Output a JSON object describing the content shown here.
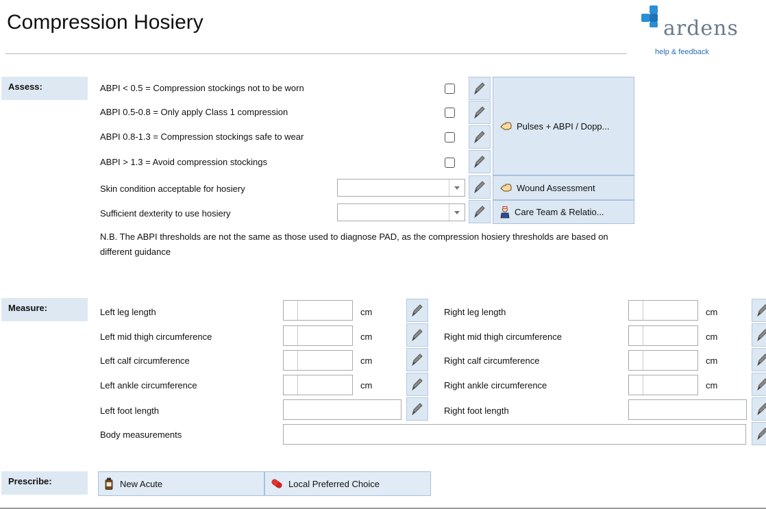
{
  "header": {
    "title": "Compression Hosiery",
    "brand": "ardens",
    "help_link": "help & feedback"
  },
  "colors": {
    "brand_blue": "#2a8fd6",
    "section_bg": "#dde8f3",
    "button_bg": "#dbe7f3"
  },
  "assess": {
    "label": "Assess:",
    "abpi_rows": [
      {
        "label": "ABPI < 0.5 = Compression stockings not to be worn",
        "checked": false
      },
      {
        "label": "ABPI 0.5-0.8 = Only apply Class 1 compression",
        "checked": false
      },
      {
        "label": "ABPI 0.8-1.3 = Compression stockings safe to wear",
        "checked": false
      },
      {
        "label": "ABPI > 1.3 = Avoid compression stockings",
        "checked": false
      }
    ],
    "dropdowns": [
      {
        "label": "Skin condition acceptable for hosiery",
        "value": ""
      },
      {
        "label": "Sufficient dexterity to use hosiery",
        "value": ""
      }
    ],
    "buttons": {
      "pulses": "Pulses + ABPI / Dopp...",
      "wound": "Wound Assessment",
      "care_team": "Care Team & Relatio..."
    },
    "note": "N.B. The ABPI thresholds are not the same as those used to diagnose PAD, as the compression hosiery thresholds are based on different guidance"
  },
  "measure": {
    "label": "Measure:",
    "unit": "cm",
    "left": [
      {
        "label": "Left leg length",
        "value": ""
      },
      {
        "label": "Left mid thigh circumference",
        "value": ""
      },
      {
        "label": "Left calf circumference",
        "value": ""
      },
      {
        "label": "Left ankle circumference",
        "value": ""
      }
    ],
    "right": [
      {
        "label": "Right leg length",
        "value": ""
      },
      {
        "label": "Right mid thigh circumference",
        "value": ""
      },
      {
        "label": "Right calf circumference",
        "value": ""
      },
      {
        "label": "Right ankle circumference",
        "value": ""
      }
    ],
    "left_foot": {
      "label": "Left foot length",
      "value": ""
    },
    "right_foot": {
      "label": "Right foot length",
      "value": ""
    },
    "body": {
      "label": "Body measurements",
      "value": ""
    }
  },
  "prescribe": {
    "label": "Prescribe:",
    "new_acute": "New Acute",
    "local_choice": "Local Preferred Choice"
  }
}
